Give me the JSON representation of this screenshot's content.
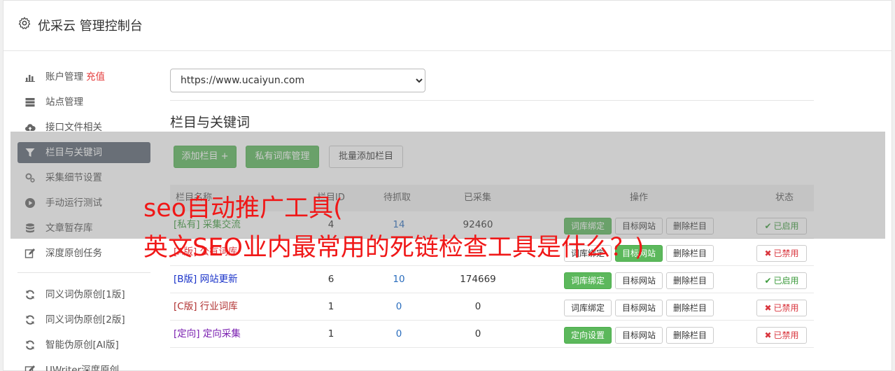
{
  "app": {
    "title": "优采云 管理控制台"
  },
  "sidebar": {
    "items": [
      {
        "label": "账户管理",
        "extra": "充值",
        "icon": "bar-chart-icon"
      },
      {
        "label": "站点管理",
        "icon": "server-icon"
      },
      {
        "label": "接口文件相关",
        "icon": "cloud-upload-icon"
      },
      {
        "label": "栏目与关键词",
        "icon": "filter-icon",
        "active": true
      },
      {
        "label": "采集细节设置",
        "icon": "gears-icon"
      },
      {
        "label": "手动运行测试",
        "icon": "play-circle-icon"
      },
      {
        "label": "文章暂存库",
        "icon": "database-icon"
      },
      {
        "label": "深度原创任务",
        "icon": "edit-icon"
      }
    ],
    "items2": [
      {
        "label": "同义词伪原创[1版]",
        "icon": "refresh-icon"
      },
      {
        "label": "同义词伪原创[2版]",
        "icon": "refresh-icon"
      },
      {
        "label": "智能伪原创[AI版]",
        "icon": "refresh-icon"
      },
      {
        "label": "UWriter深度原创",
        "icon": "edit-icon"
      }
    ]
  },
  "main": {
    "site_select": "https://www.ucaiyun.com",
    "section_title": "栏目与关键词",
    "buttons": {
      "add_column": "添加栏目 +",
      "private_lib": "私有词库管理",
      "batch_add": "批量添加栏目"
    },
    "table": {
      "headers": [
        "栏目名称",
        "栏目ID",
        "待抓取",
        "已采集",
        "操作",
        "状态"
      ],
      "rows": [
        {
          "name": "[私有] 采集交流",
          "name_color": "#3c9a3c",
          "id": "4",
          "pending": "14",
          "collected": "92460",
          "op1": "词库绑定",
          "op1_green": true,
          "op2": "目标网站",
          "op3": "删除栏目",
          "status": "已启用",
          "status_on": true
        },
        {
          "name": "[A版] 公有词库",
          "name_color": "#d9363e",
          "id": "",
          "pending": "",
          "collected": "",
          "op1": "词库绑定",
          "op1_green": false,
          "op2": "目标网站",
          "op2_green": true,
          "op3": "删除栏目",
          "status": "已禁用",
          "status_on": false
        },
        {
          "name": "[B版] 网站更新",
          "name_color": "#1a33c9",
          "id": "6",
          "pending": "10",
          "collected": "174669",
          "op1": "词库绑定",
          "op1_green": true,
          "op2": "目标网站",
          "op3": "删除栏目",
          "status": "已启用",
          "status_on": true
        },
        {
          "name": "[C版] 行业词库",
          "name_color": "#b03030",
          "id": "1",
          "pending": "0",
          "collected": "0",
          "op1": "词库绑定",
          "op1_green": false,
          "op2": "目标网站",
          "op3": "删除栏目",
          "status": "已禁用",
          "status_on": false
        },
        {
          "name": "[定向] 定向采集",
          "name_color": "#7a1fb0",
          "id": "1",
          "pending": "0",
          "collected": "0",
          "op1": "定向设置",
          "op1_green": true,
          "op2": "目标网站",
          "op3": "删除栏目",
          "status": "已禁用",
          "status_on": false
        }
      ]
    }
  },
  "overlay": {
    "line1": "seo自动推广工具(",
    "line2": "英文SEO业内最常用的死链检查工具是什么？)"
  },
  "colors": {
    "green": "#5cb85c",
    "red": "#d9363e",
    "active_nav": "#5a6572",
    "banner": "#f01818"
  }
}
